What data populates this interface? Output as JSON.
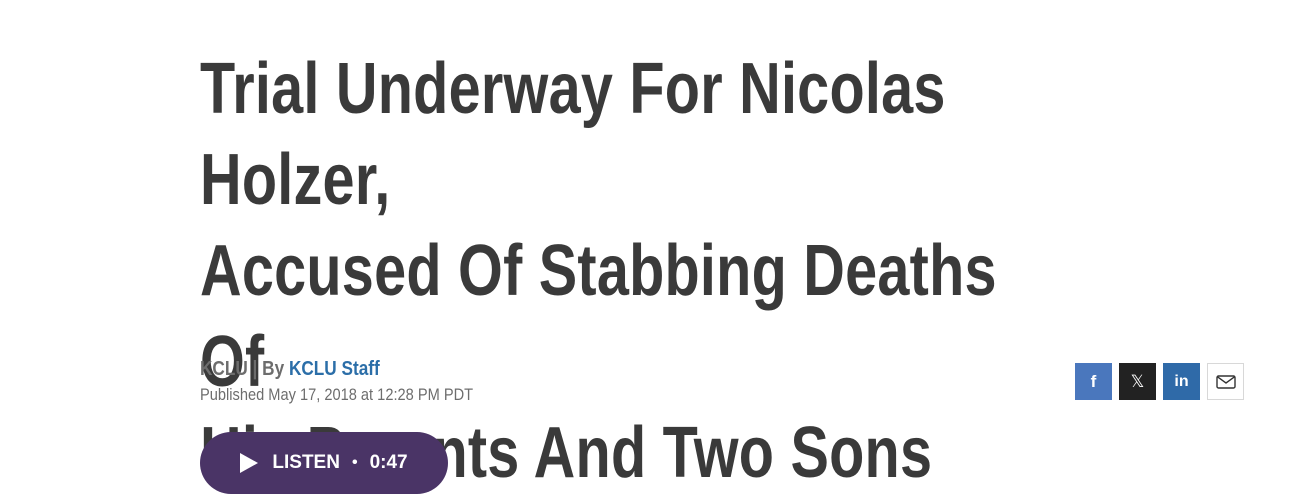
{
  "article": {
    "headline_lines": [
      "Trial Underway For Nicolas Holzer,",
      "Accused Of Stabbing Deaths Of",
      "His Parents And Two Sons"
    ],
    "source": "KCLU",
    "separator": "|",
    "by_label": "By",
    "author": "KCLU Staff",
    "published": "Published May 17, 2018 at 12:28 PM PDT"
  },
  "audio": {
    "label": "LISTEN",
    "dot": "•",
    "duration": "0:47"
  },
  "share": {
    "facebook_glyph": "f",
    "x_glyph": "𝕏",
    "linkedin_glyph": "in",
    "icons": [
      "facebook-icon",
      "x-icon",
      "linkedin-icon",
      "email-icon"
    ]
  },
  "colors": {
    "headline": "#3a3a3a",
    "author_link": "#2b6ea8",
    "listen_bg": "#4a3466",
    "facebook": "#4a77bd",
    "x": "#222222",
    "linkedin": "#2f6aa8"
  }
}
